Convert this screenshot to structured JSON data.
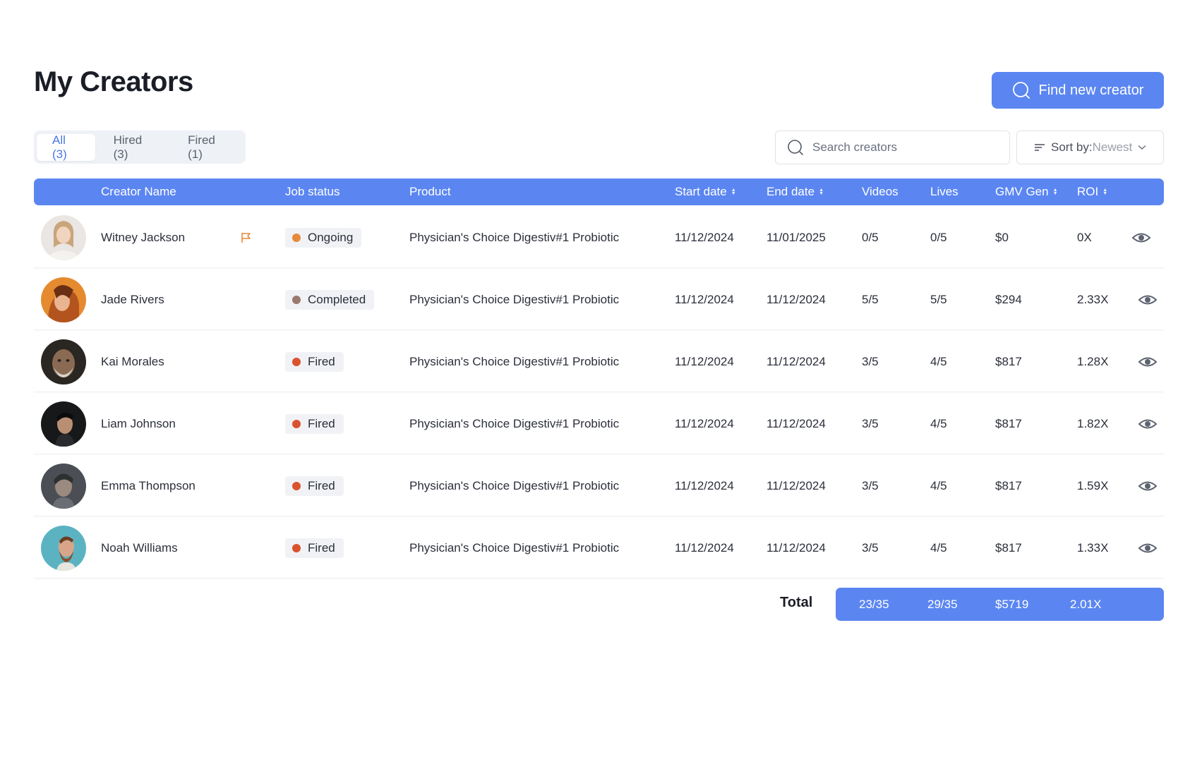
{
  "header": {
    "title": "My Creators",
    "find_button_label": "Find new creator"
  },
  "tabs": [
    {
      "label": "All (3)",
      "active": true
    },
    {
      "label": "Hired (3)",
      "active": false
    },
    {
      "label": "Fired (1)",
      "active": false
    }
  ],
  "search": {
    "placeholder": "Search creators"
  },
  "sort": {
    "label": "Sort by:",
    "value": "Newest"
  },
  "table": {
    "columns": [
      "Creator Name",
      "Job status",
      "Product",
      "Start date",
      "End date",
      "Videos",
      "Lives",
      "GMV Gen",
      "ROI"
    ],
    "rows": [
      {
        "name": "Witney Jackson",
        "flagged": true,
        "status": "Ongoing",
        "status_color": "#e58a3a",
        "product": "Physician's Choice Digestiv#1 Probiotic",
        "start": "11/12/2024",
        "end": "11/01/2025",
        "videos": "0/5",
        "lives": "0/5",
        "gmv": "$0",
        "roi": "0X"
      },
      {
        "name": "Jade Rivers",
        "flagged": false,
        "status": "Completed",
        "status_color": "#9a7a6e",
        "product": "Physician's Choice Digestiv#1 Probiotic",
        "start": "11/12/2024",
        "end": "11/12/2024",
        "videos": "5/5",
        "lives": "5/5",
        "gmv": "$294",
        "roi": "2.33X"
      },
      {
        "name": "Kai Morales",
        "flagged": false,
        "status": "Fired",
        "status_color": "#d9532f",
        "product": "Physician's Choice Digestiv#1 Probiotic",
        "start": "11/12/2024",
        "end": "11/12/2024",
        "videos": "3/5",
        "lives": "4/5",
        "gmv": "$817",
        "roi": "1.28X"
      },
      {
        "name": "Liam Johnson",
        "flagged": false,
        "status": "Fired",
        "status_color": "#d9532f",
        "product": "Physician's Choice Digestiv#1 Probiotic",
        "start": "11/12/2024",
        "end": "11/12/2024",
        "videos": "3/5",
        "lives": "4/5",
        "gmv": "$817",
        "roi": "1.82X"
      },
      {
        "name": "Emma Thompson",
        "flagged": false,
        "status": "Fired",
        "status_color": "#d9532f",
        "product": "Physician's Choice Digestiv#1 Probiotic",
        "start": "11/12/2024",
        "end": "11/12/2024",
        "videos": "3/5",
        "lives": "4/5",
        "gmv": "$817",
        "roi": "1.59X"
      },
      {
        "name": "Noah Williams",
        "flagged": false,
        "status": "Fired",
        "status_color": "#d9532f",
        "product": "Physician's Choice Digestiv#1 Probiotic",
        "start": "11/12/2024",
        "end": "11/12/2024",
        "videos": "3/5",
        "lives": "4/5",
        "gmv": "$817",
        "roi": "1.33X"
      }
    ]
  },
  "totals": {
    "label": "Total",
    "videos": "23/35",
    "lives": "29/35",
    "gmv": "$5719",
    "roi": "2.01X"
  },
  "colors": {
    "accent": "#5b86f1",
    "ongoing": "#e58a3a",
    "completed": "#9a7a6e",
    "fired": "#d9532f"
  }
}
